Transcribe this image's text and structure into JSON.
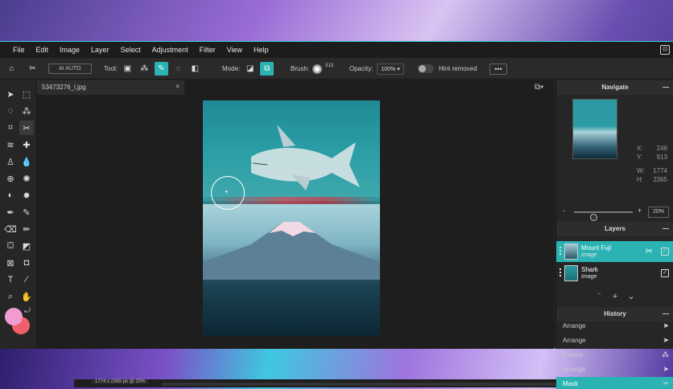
{
  "menu": [
    "File",
    "Edit",
    "Image",
    "Layer",
    "Select",
    "Adjustment",
    "Filter",
    "View",
    "Help"
  ],
  "window_button": "⊡",
  "toolbar": {
    "ai_auto": "AI AUTO",
    "tool_label": "Tool:",
    "mode_label": "Mode:",
    "brush_label": "Brush:",
    "brush_size": "513",
    "opacity_label": "Opacity:",
    "opacity_value": "100%",
    "hint_label": "Hint removed",
    "more": "•••"
  },
  "document": {
    "tab_name": "53473276_l.jpg",
    "close": "×",
    "status": "1774 x 2365 px @ 20%"
  },
  "navigate": {
    "title": "Navigate",
    "x_label": "X:",
    "x_value": "246",
    "y_label": "Y:",
    "y_value": "913",
    "w_label": "W:",
    "w_value": "1774",
    "h_label": "H:",
    "h_value": "2365",
    "zoom_minus": "-",
    "zoom_plus": "+",
    "zoom_value": "20%",
    "zoom_level": 0.2
  },
  "layers": {
    "title": "Layers",
    "items": [
      {
        "name": "Mount Fuji",
        "type": "Image",
        "selected": true
      },
      {
        "name": "Shark",
        "type": "Image",
        "selected": false
      }
    ]
  },
  "history": {
    "title": "History",
    "items": [
      {
        "label": "Arrange",
        "icon": "pointer-icon"
      },
      {
        "label": "Arrange",
        "icon": "pointer-icon"
      },
      {
        "label": "Curves",
        "icon": "curves-icon"
      },
      {
        "label": "Arrange",
        "icon": "pointer-icon"
      },
      {
        "label": "Mask",
        "icon": "scissors-icon"
      }
    ]
  },
  "colors": {
    "accent": "#2bb3b3",
    "primary_swatch": "#f29bd0",
    "secondary_swatch": "#f0606a"
  }
}
